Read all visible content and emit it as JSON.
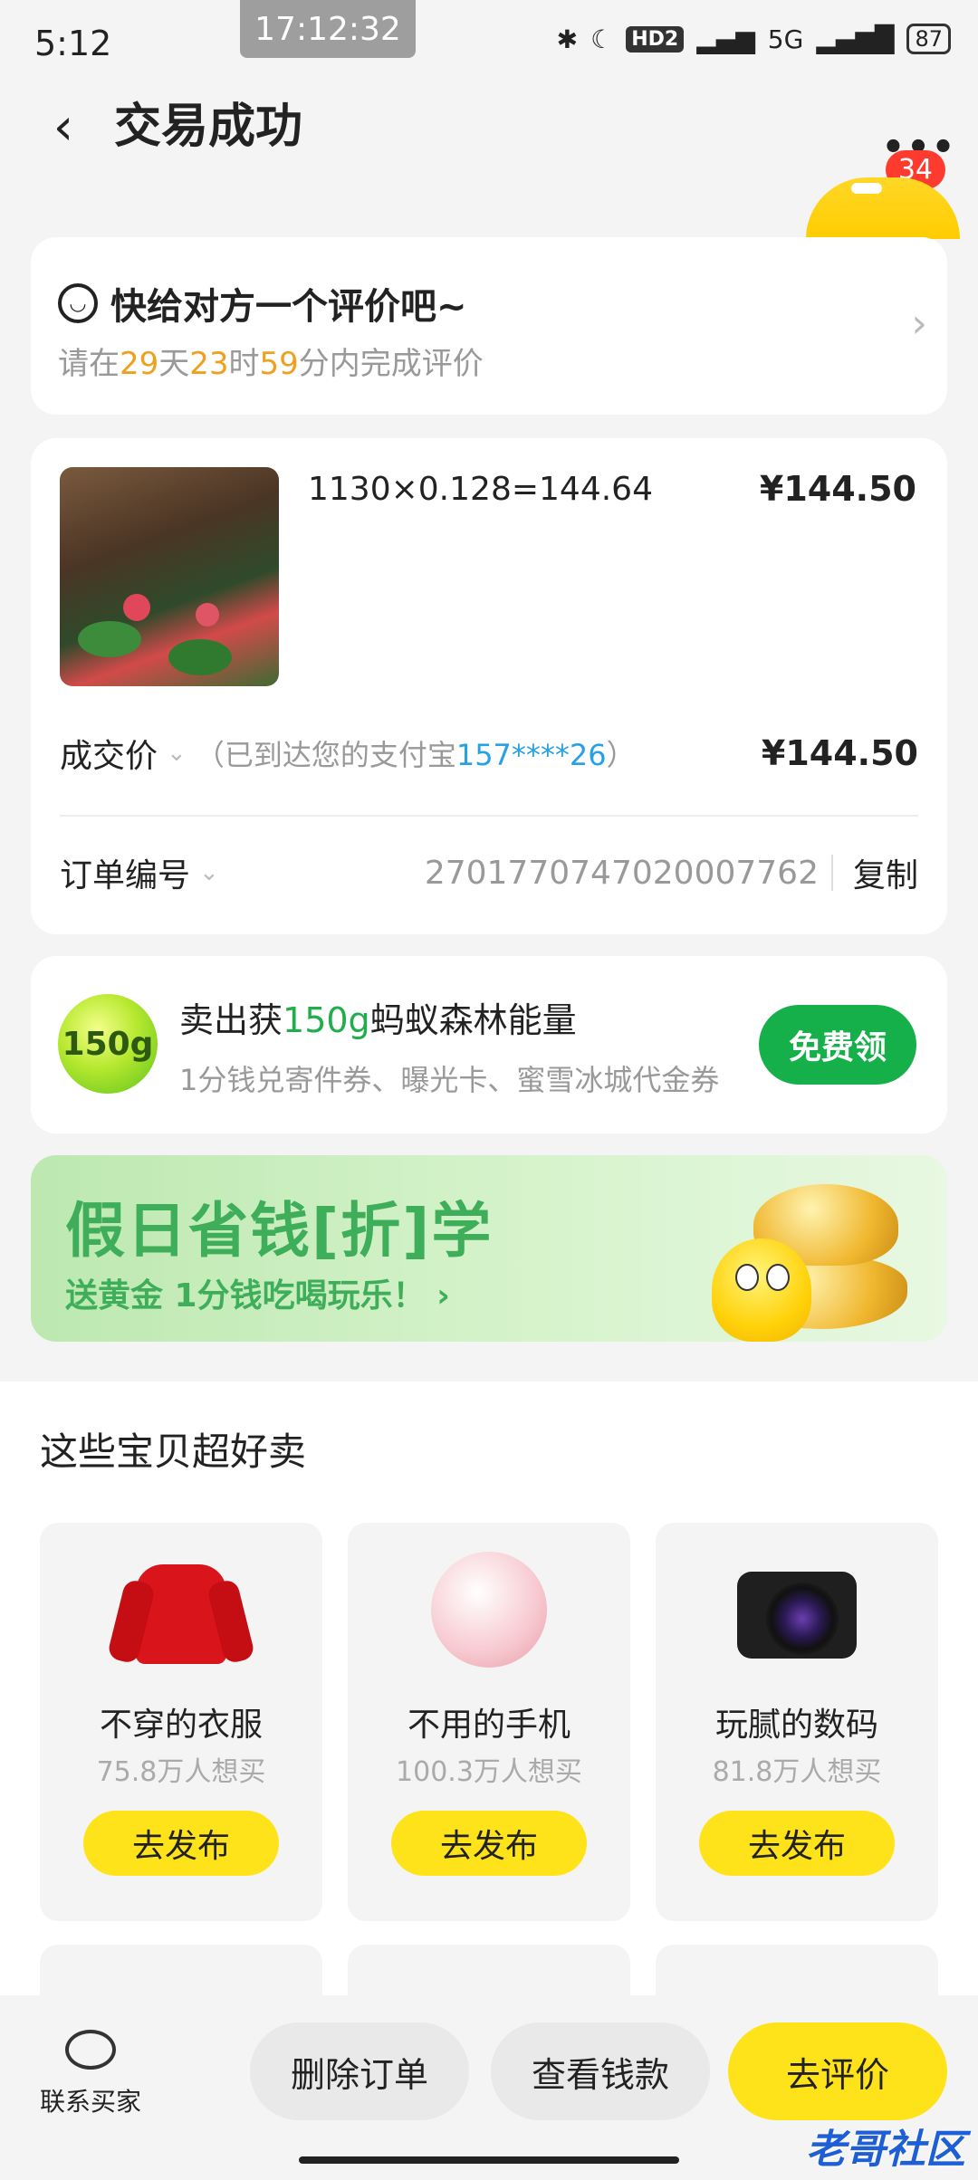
{
  "status_bar": {
    "time": "5:12",
    "timestamp": "17:12:32",
    "network": "5G",
    "hd": "HD2",
    "battery": "87"
  },
  "header": {
    "title": "交易成功",
    "badge_count": "34"
  },
  "review": {
    "title": "快给对方一个评价吧~",
    "prefix": "请在",
    "days": "29",
    "days_unit": "天",
    "hours": "23",
    "hours_unit": "时",
    "minutes": "59",
    "suffix": "分内完成评价"
  },
  "order": {
    "item_title": "1130×0.128=144.64",
    "item_price": "¥144.50",
    "deal_label": "成交价",
    "deal_note_prefix": "（已到达您的支付宝",
    "deal_note_account": "157****26",
    "deal_note_suffix": "）",
    "deal_price": "¥144.50",
    "order_no_label": "订单编号",
    "order_no": "2701770747020007762",
    "copy_label": "复制"
  },
  "energy": {
    "badge": "150g",
    "title_prefix": "卖出获",
    "title_highlight": "150g",
    "title_suffix": "蚂蚁森林能量",
    "subtitle": "1分钱兑寄件券、曝光卡、蜜雪冰城代金券",
    "button": "免费领"
  },
  "promo": {
    "title": "假日省钱[折]学",
    "subtitle": "送黄金 1分钱吃喝玩乐！ ›"
  },
  "section": {
    "title": "这些宝贝超好卖",
    "tiles": [
      {
        "name": "不穿的衣服",
        "sub": "75.8万人想买",
        "button": "去发布",
        "icon": "sweater-icon"
      },
      {
        "name": "不用的手机",
        "sub": "100.3万人想买",
        "button": "去发布",
        "icon": "phone-icon"
      },
      {
        "name": "玩腻的数码",
        "sub": "81.8万人想买",
        "button": "去发布",
        "icon": "camera-icon"
      }
    ]
  },
  "bottom_bar": {
    "contact": "联系买家",
    "delete": "删除订单",
    "view_money": "查看钱款",
    "review": "去评价"
  },
  "watermark": "老哥社区"
}
